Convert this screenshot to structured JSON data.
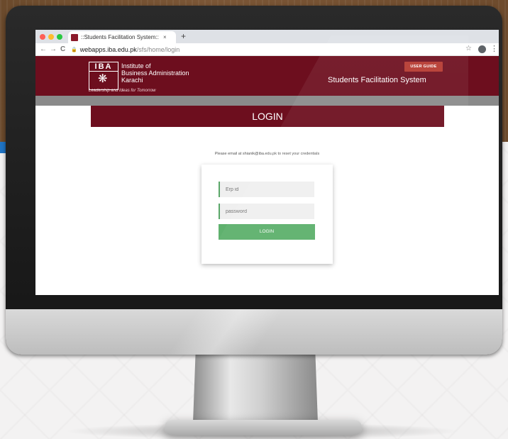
{
  "browser": {
    "tab_title": "::Students Facilitation System::",
    "tab_close": "×",
    "new_tab": "+",
    "url_host": "webapps.iba.edu.pk",
    "url_path": "/sfs/home/login",
    "back": "←",
    "forward": "→",
    "reload": "C",
    "bookmark": "☆",
    "menu": "⋮"
  },
  "header": {
    "logo_text": "IBA",
    "institute_line1": "Institute of",
    "institute_line2": "Business Administration",
    "institute_line3": "Karachi",
    "tagline": "Leadership and Ideas for Tomorrow",
    "user_guide": "USER GUIDE",
    "system_title": "Students Facilitation System"
  },
  "login": {
    "banner": "LOGIN",
    "note": "Please email at shianik@iba.edu.pk to reset your credentials",
    "erp_placeholder": "Erp id",
    "password_placeholder": "password",
    "button": "LOGIN"
  },
  "colors": {
    "brand_maroon": "#6d0e1e",
    "button_green": "#5fb16e",
    "guide_red": "#b5382f"
  }
}
